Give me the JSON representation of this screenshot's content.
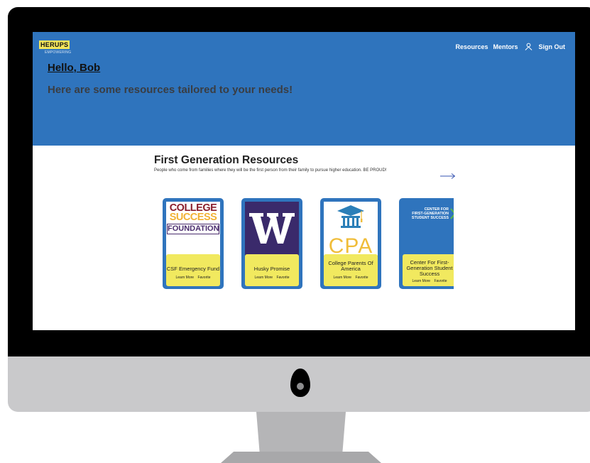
{
  "header": {
    "logo_main": "HERUPS",
    "logo_sub": "EMPOWERING",
    "nav": [
      "Resources",
      "Mentors",
      "Sign Out"
    ]
  },
  "hero": {
    "greeting": "Hello, Bob",
    "subtitle": "Here are some resources tailored to your needs!"
  },
  "section": {
    "title": "First Generation Resources",
    "description": "People who come from families where they will be the first person from their family to pursue higher education. BE PROUD!"
  },
  "cards": [
    {
      "name": "CSF Emergency Fund",
      "logo_lines": [
        "COLLEGE",
        "SUCCESS",
        "FOUNDATION"
      ],
      "learn_more": "Learn More",
      "favorite": "Favorite"
    },
    {
      "name": "Husky Promise",
      "learn_more": "Learn More",
      "favorite": "Favorite"
    },
    {
      "name": "College Parents Of America",
      "logo_text": "CPA",
      "learn_more": "Learn More",
      "favorite": "Favorite"
    },
    {
      "name": "Center For First-Generation Student Success",
      "logo_lines": [
        "CENTER FOR",
        "FIRST-GENERATION",
        "STUDENT SUCCESS"
      ],
      "learn_more": "Learn More",
      "favorite": "Favorite"
    }
  ],
  "colors": {
    "hero_blue": "#2f74bd",
    "card_yellow": "#f1e95f",
    "logo_yellow": "#f3e55b"
  },
  "icons": {
    "user": "user-icon",
    "next": "arrow-right-icon"
  }
}
